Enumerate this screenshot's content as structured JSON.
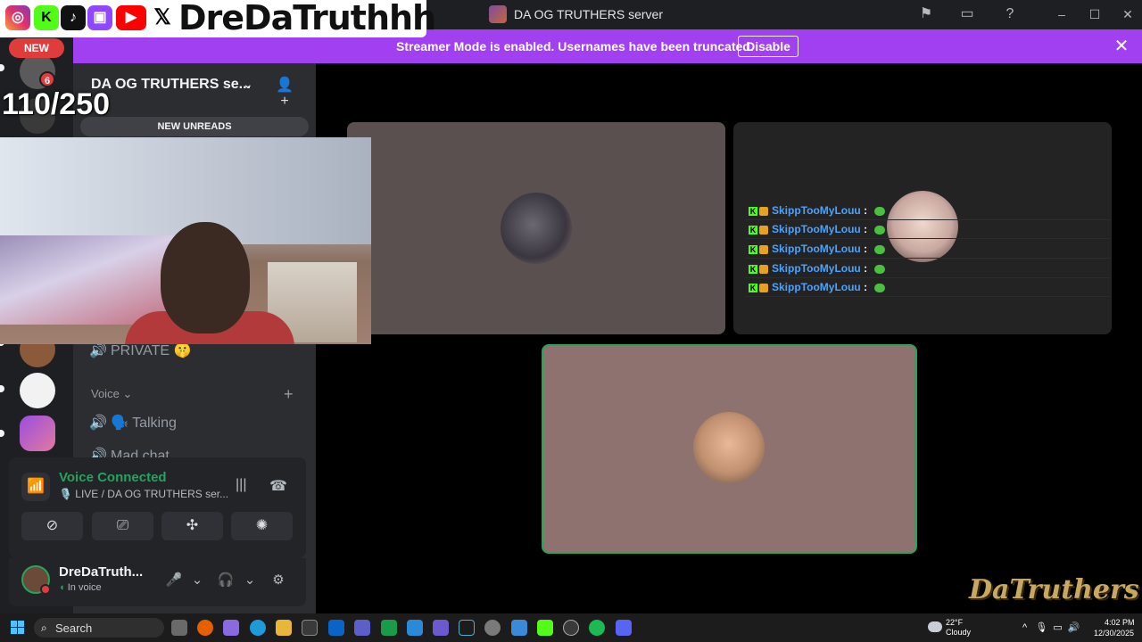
{
  "window": {
    "title": "DA OG TRUTHERS server"
  },
  "overlay": {
    "handle": "DreDaTruthhh",
    "counter": "110/250",
    "watermark": "DaTruthers"
  },
  "banner": {
    "text": "Streamer Mode is enabled. Usernames have been truncated.",
    "disable_label": "Disable"
  },
  "rail": {
    "new_label": "NEW",
    "mention_count": "6"
  },
  "sidebar": {
    "server_name": "DA OG TRUTHERS se...",
    "new_unreads": "NEW UNREADS",
    "private_channel": "PRIVATE 🤫",
    "voice_category": "Voice",
    "voice_channels": [
      "🗣️ Talking",
      "Mad chat"
    ]
  },
  "voice_panel": {
    "title": "Voice Connected",
    "subtitle": "🎙️ LIVE / DA OG TRUTHERS ser..."
  },
  "user_panel": {
    "username": "DreDaTruth...",
    "status": "In voice"
  },
  "chat": {
    "rows": [
      {
        "name": "SkippTooMyLouu",
        "colon": ":"
      },
      {
        "name": "SkippTooMyLouu",
        "colon": ":"
      },
      {
        "name": "SkippTooMyLouu",
        "colon": ":"
      },
      {
        "name": "SkippTooMyLouu",
        "colon": ":"
      },
      {
        "name": "SkippTooMyLouu",
        "colon": ":"
      }
    ]
  },
  "taskbar": {
    "search_label": "Search",
    "weather_temp": "22°F",
    "weather_desc": "Cloudy",
    "time": "4:02 PM",
    "date": "12/30/2025"
  },
  "colors": {
    "banner": "#a040f0",
    "voice_green": "#23a55a",
    "mention_red": "#e03c3c"
  }
}
